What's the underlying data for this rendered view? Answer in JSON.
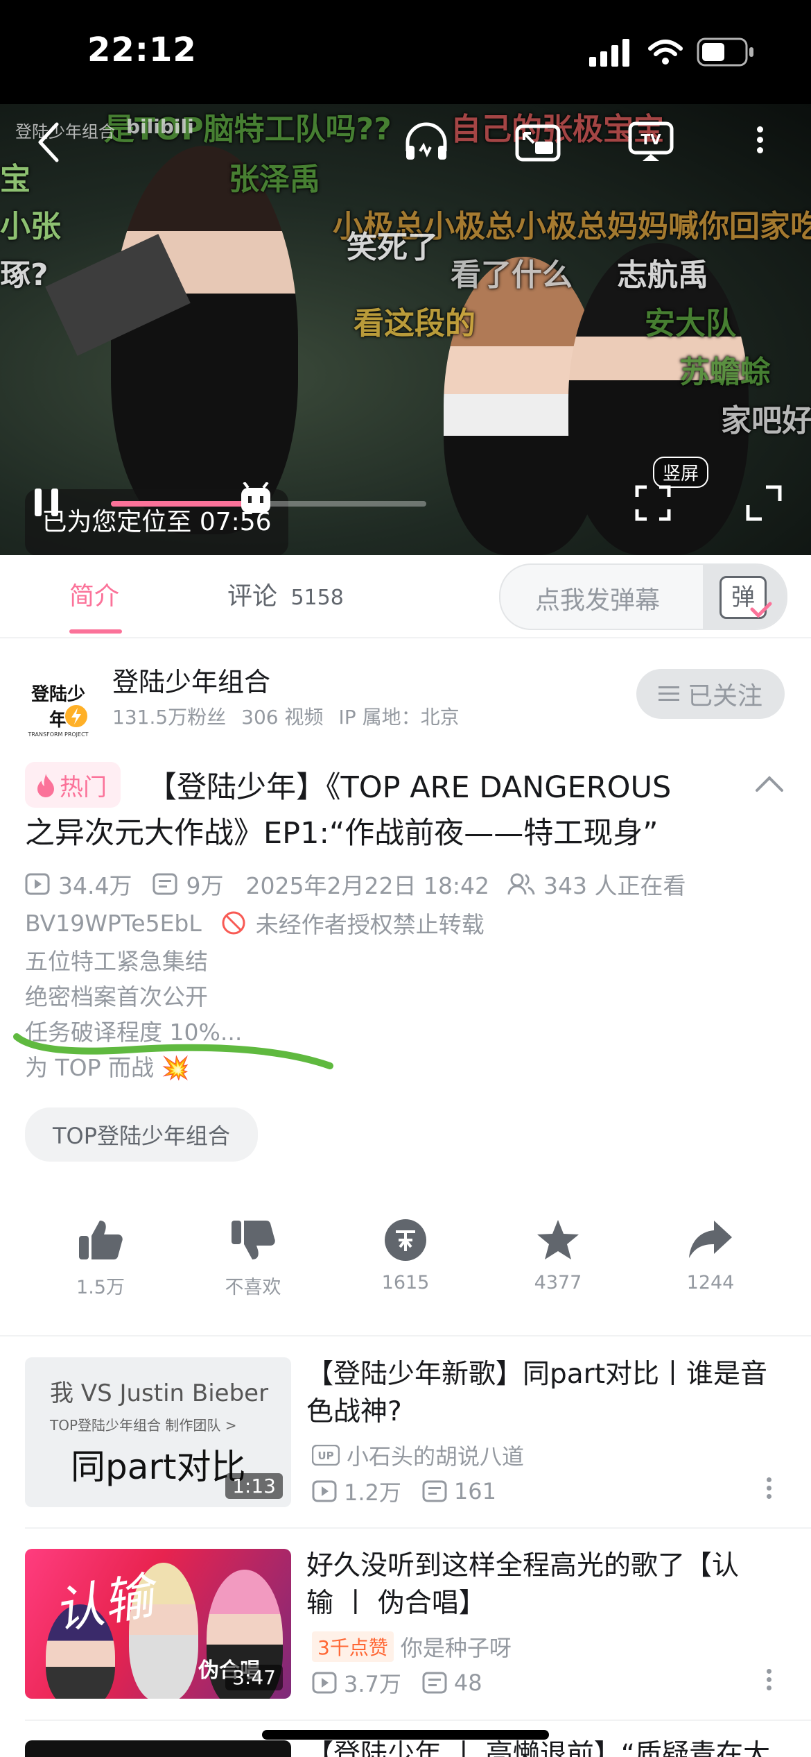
{
  "status": {
    "time": "22:12"
  },
  "player": {
    "channel_watermark": "登陆少年组合",
    "site_watermark": "bilibili",
    "toast": "已为您定位至 07:56",
    "portrait_label": "竖屏",
    "progress": 0.46,
    "danmaku": [
      "是TOP脑特工队吗??",
      "自己的张极宝宝",
      "宝",
      "张泽禹",
      "小张",
      "小极总小极总小极总妈妈喊你回家吃",
      "琢?",
      "笑死了",
      "看了什么",
      "志航禹",
      "看这段的",
      "安大队",
      "苏蟾蜍",
      "家吧好",
      "已为您定位至"
    ]
  },
  "tabs": {
    "intro": "简介",
    "comments": "评论",
    "comments_count": "5158",
    "danmaku_placeholder": "点我发弹幕",
    "danmaku_btn": "弹"
  },
  "author": {
    "logo_text": "登陆少年",
    "logo_sub": "TRANSFORM PROJECT",
    "name": "登陆少年组合",
    "fans": "131.5万粉丝",
    "videos": "306 视频",
    "ip": "IP 属地：北京",
    "follow_label": "已关注"
  },
  "video": {
    "hot_badge": "热门",
    "title_line1": "【登陆少年】《TOP ARE DANGEROUS",
    "title_line2": "之异次元大作战》EP1:“作战前夜——特工现身”",
    "views": "34.4万",
    "danmaku_count": "9万",
    "date": "2025年2月22日 18:42",
    "watching": "343 人正在看",
    "bvid": "BV19WPTe5EbL",
    "copyright": "未经作者授权禁止转载",
    "desc": [
      "五位特工紧急集结",
      "绝密档案首次公开",
      "任务破译程度 10%...",
      "为 TOP 而战 💥"
    ],
    "tag": "TOP登陆少年组合"
  },
  "actions": [
    {
      "name": "like",
      "label": "1.5万"
    },
    {
      "name": "dislike",
      "label": "不喜欢"
    },
    {
      "name": "coin",
      "label": "1615"
    },
    {
      "name": "favorite",
      "label": "4377"
    },
    {
      "name": "share",
      "label": "1244"
    }
  ],
  "recommendations": [
    {
      "title_line1": "【登陆少年新歌】同part对比丨谁是音",
      "title_line2": "色战神?",
      "up": "小石头的胡说八道",
      "views": "1.2万",
      "danmaku": "161",
      "duration": "1:13",
      "thumb_top": "我 VS Justin Bieber",
      "thumb_sub": "TOP登陆少年组合  制作团队 >",
      "thumb_main": "同part对比"
    },
    {
      "title_line1": "好久没听到这样全程高光的歌了【认",
      "title_line2": "输 丨 伪合唱】",
      "badge": "3千点赞",
      "up": "你是种子呀",
      "views": "3.7万",
      "danmaku": "48",
      "duration": "3:47",
      "thumb_text": "认输",
      "thumb_sub": "伪合唱"
    },
    {
      "title_line1": "【登陆少年 丨 亮懒退前】“质疑青在大"
    }
  ],
  "colors": {
    "accent": "#fb7299",
    "highlight_stroke": "#5fb93f"
  }
}
